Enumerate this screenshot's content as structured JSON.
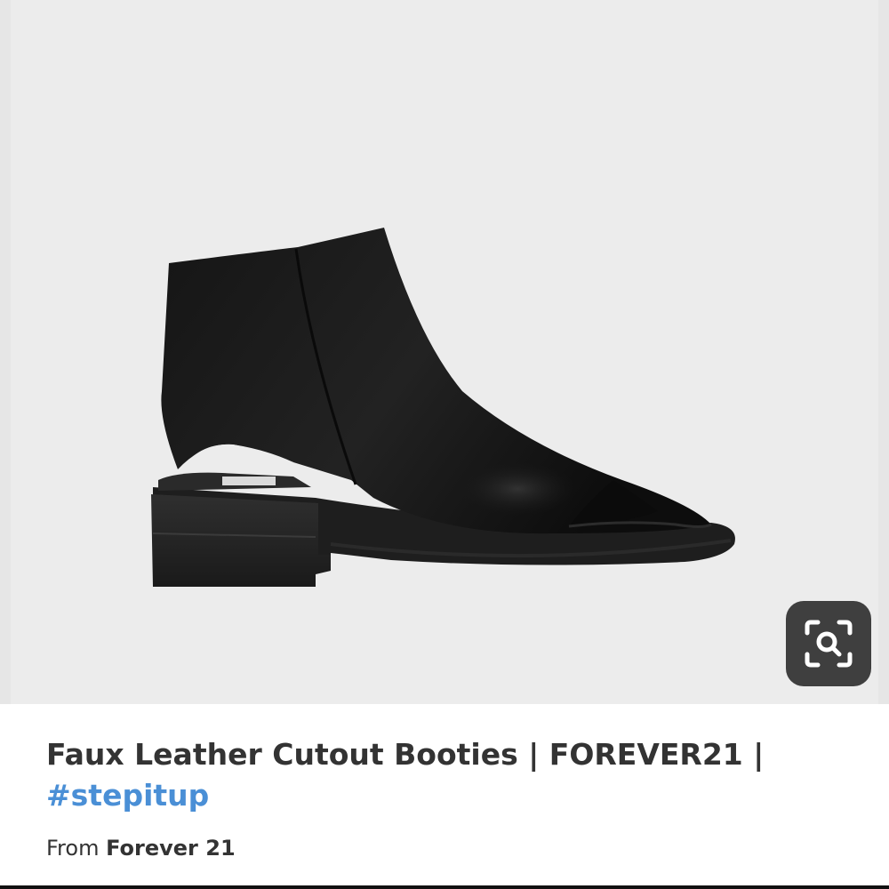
{
  "product": {
    "title_main": "Faux Leather Cutout Booties | FOREVER21 |",
    "hashtag": "#stepitup",
    "source_prefix": "From",
    "source_name": "Forever 21"
  },
  "image": {
    "alt": "Black faux leather cutout peep-toe bootie"
  },
  "lens": {
    "icon": "visual-search-icon"
  },
  "colors": {
    "background": "#ececec",
    "hashtag": "#4a8fd6",
    "text": "#333333",
    "lens_button": "#3f3f3f"
  }
}
